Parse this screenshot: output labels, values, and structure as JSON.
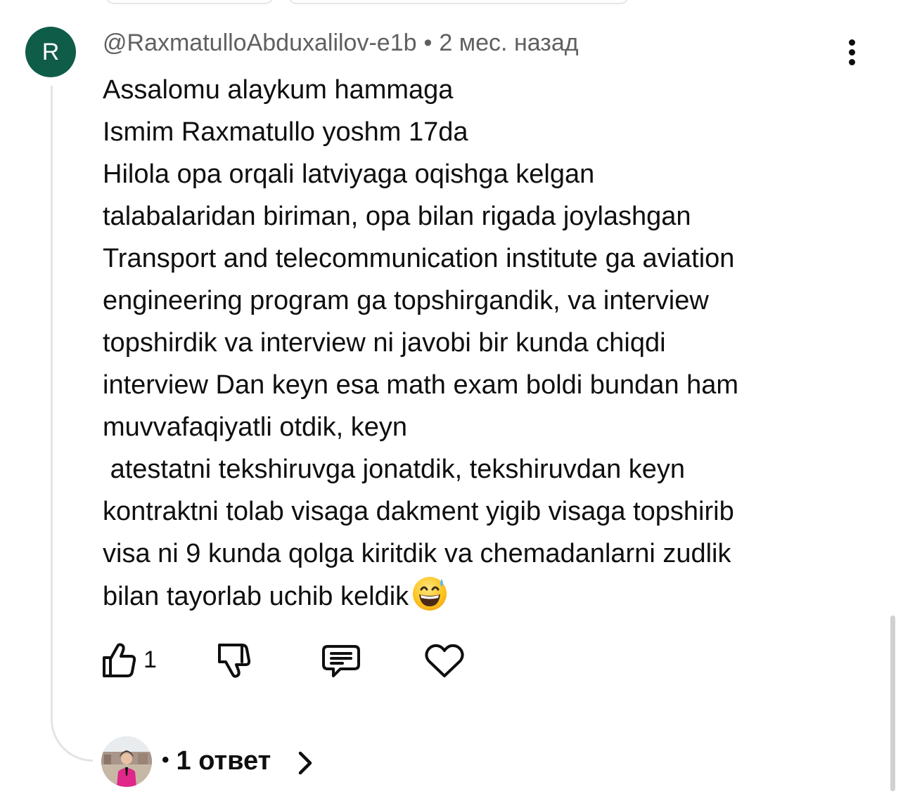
{
  "comment": {
    "avatar_letter": "R",
    "author": "@RaxmatulloAbduxalilov-e1b",
    "separator": "•",
    "timestamp": "2 мес. назад",
    "text": "Assalomu alaykum hammaga\nIsmim Raxmatullo yoshm 17da\nHilola opa orqali latviyaga oqishga kelgan\ntalabalaridan biriman, opa bilan rigada joylashgan\nTransport and telecommunication institute ga aviation\nengineering program ga topshirgandik, va interview\ntopshirdik va interview ni javobi bir kunda chiqdi\ninterview Dan keyn esa math exam boldi bundan ham\nmuvvafaqiyatli otdik, keyn\n atestatni tekshiruvga jonatdik, tekshiruvdan keyn\nkontraktni tolab visaga dakment yigib visaga topshirib\nvisa ni 9 kunda qolga kiritdik va chemadanlarni zudlik\nbilan tayorlab uchib keldik",
    "emoji": "grinning-face-with-sweat"
  },
  "actions": {
    "like_icon": "thumbs-up-icon",
    "like_count": "1",
    "dislike_icon": "thumbs-down-icon",
    "reply_icon": "comment-icon",
    "heart_icon": "heart-icon"
  },
  "replies": {
    "bullet": "•",
    "label": "1 ответ"
  },
  "colors": {
    "avatar_bg": "#0f5c49",
    "meta_text": "#606060",
    "text": "#0f0f0f"
  }
}
